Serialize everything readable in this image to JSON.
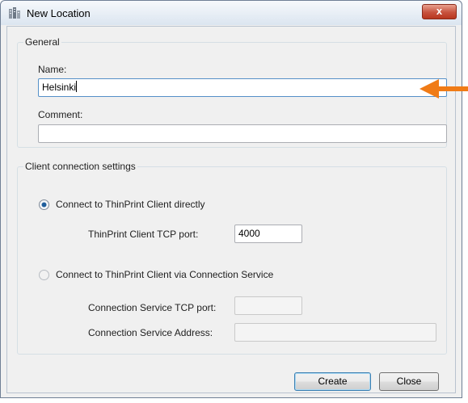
{
  "window": {
    "title": "New Location",
    "close_glyph": "x"
  },
  "general": {
    "title": "General",
    "name_label": "Name:",
    "name_value": "Helsinki",
    "comment_label": "Comment:",
    "comment_value": ""
  },
  "client": {
    "title": "Client connection settings",
    "options": [
      {
        "label": "Connect to ThinPrint Client directly",
        "selected": true
      },
      {
        "label": "Connect to ThinPrint Client via Connection Service",
        "selected": false
      }
    ],
    "tcp_port_label": "ThinPrint Client TCP port:",
    "tcp_port_value": "4000",
    "cs_port_label": "Connection Service TCP port:",
    "cs_port_value": "",
    "cs_address_label": "Connection Service Address:",
    "cs_address_value": ""
  },
  "buttons": {
    "create": "Create",
    "close": "Close"
  },
  "colors": {
    "annotation_arrow": "#f07b16",
    "radio_selected": "#1f5e9c",
    "focus_border": "#5590c8"
  },
  "icons": [
    "app-icon",
    "close-icon",
    "radio-selected-icon",
    "radio-unselected-icon",
    "annotation-arrow-icon"
  ]
}
